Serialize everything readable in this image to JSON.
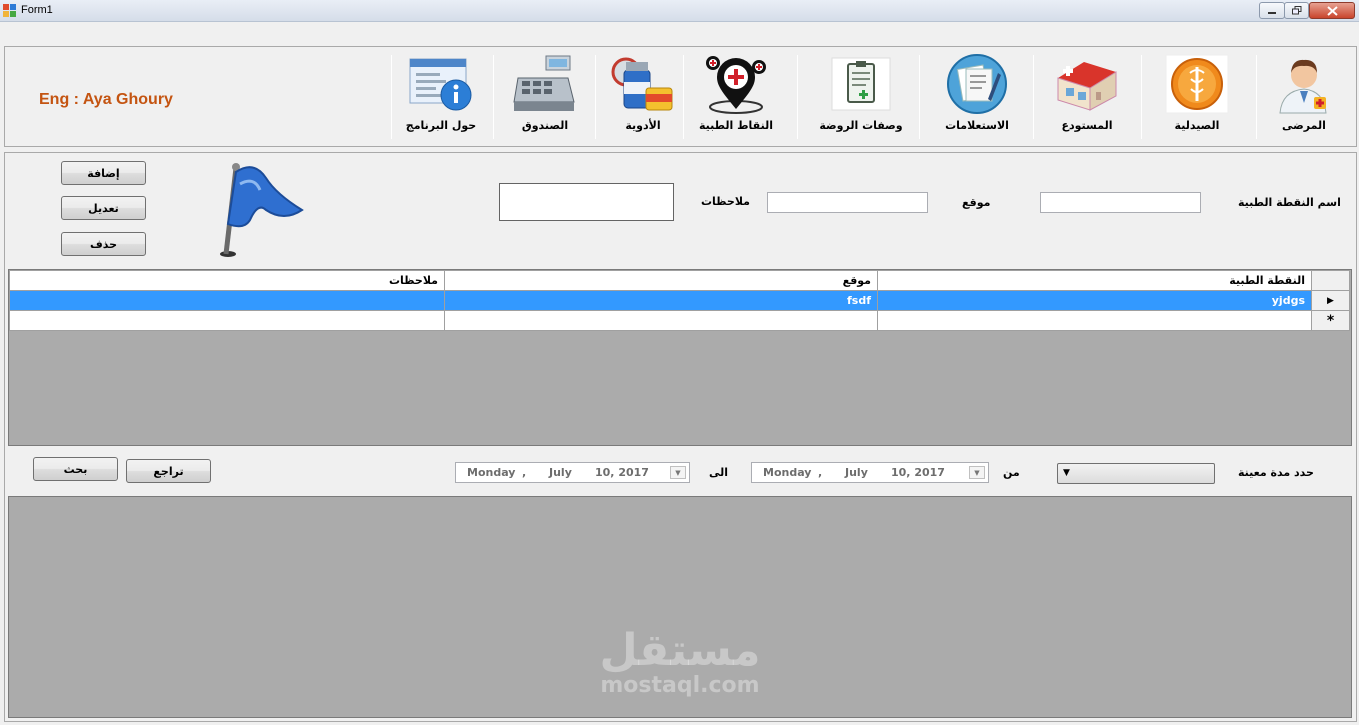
{
  "window": {
    "title": "Form1"
  },
  "header": {
    "credit": "Eng : Aya Ghoury"
  },
  "toolbar": {
    "items": [
      {
        "label": "حول البرنامج",
        "icon": "info-form-icon"
      },
      {
        "label": "الصندوق",
        "icon": "cash-register-icon"
      },
      {
        "label": "الأدوية",
        "icon": "medicine-bottles-icon"
      },
      {
        "label": "النقاط الطبية",
        "icon": "medical-map-pins-icon"
      },
      {
        "label": "وصفات الروضة",
        "icon": "prescription-clipboard-icon"
      },
      {
        "label": "الاستعلامات",
        "icon": "documents-pen-icon"
      },
      {
        "label": "المستودع",
        "icon": "warehouse-building-icon"
      },
      {
        "label": "الصيدلية",
        "icon": "pharmacy-caduceus-icon"
      },
      {
        "label": "المرضى",
        "icon": "doctor-patient-icon"
      }
    ]
  },
  "form": {
    "add_label": "إضافة",
    "edit_label": "تعديل",
    "delete_label": "حذف",
    "point_name_label": "اسم النقطة الطبية",
    "location_label": "موقع",
    "notes_label": "ملاحظات",
    "point_name_value": "",
    "location_value": "",
    "notes_value": ""
  },
  "grid": {
    "columns": [
      "النقطة الطبية",
      "موقع",
      "ملاحظات"
    ],
    "rows": [
      {
        "point": "yjdgs",
        "location": "fsdf",
        "notes": ""
      }
    ],
    "new_row_marker": "*",
    "current_row_marker": "▶"
  },
  "filter": {
    "period_label": "حدد مدة معينة",
    "from_label": "من",
    "to_label": "الى",
    "from_date": {
      "day": "Monday",
      "comma": ",",
      "month": "July",
      "date": "10, 2017"
    },
    "to_date": {
      "day": "Monday",
      "comma": ",",
      "month": "July",
      "date": "10, 2017"
    },
    "undo_label": "تراجع",
    "search_label": "بحث",
    "period_value": ""
  },
  "watermark": {
    "arabic": "مستقل",
    "latin": "mostaql.com"
  },
  "colors": {
    "accent": "#3399ff",
    "credit": "#c45411"
  }
}
